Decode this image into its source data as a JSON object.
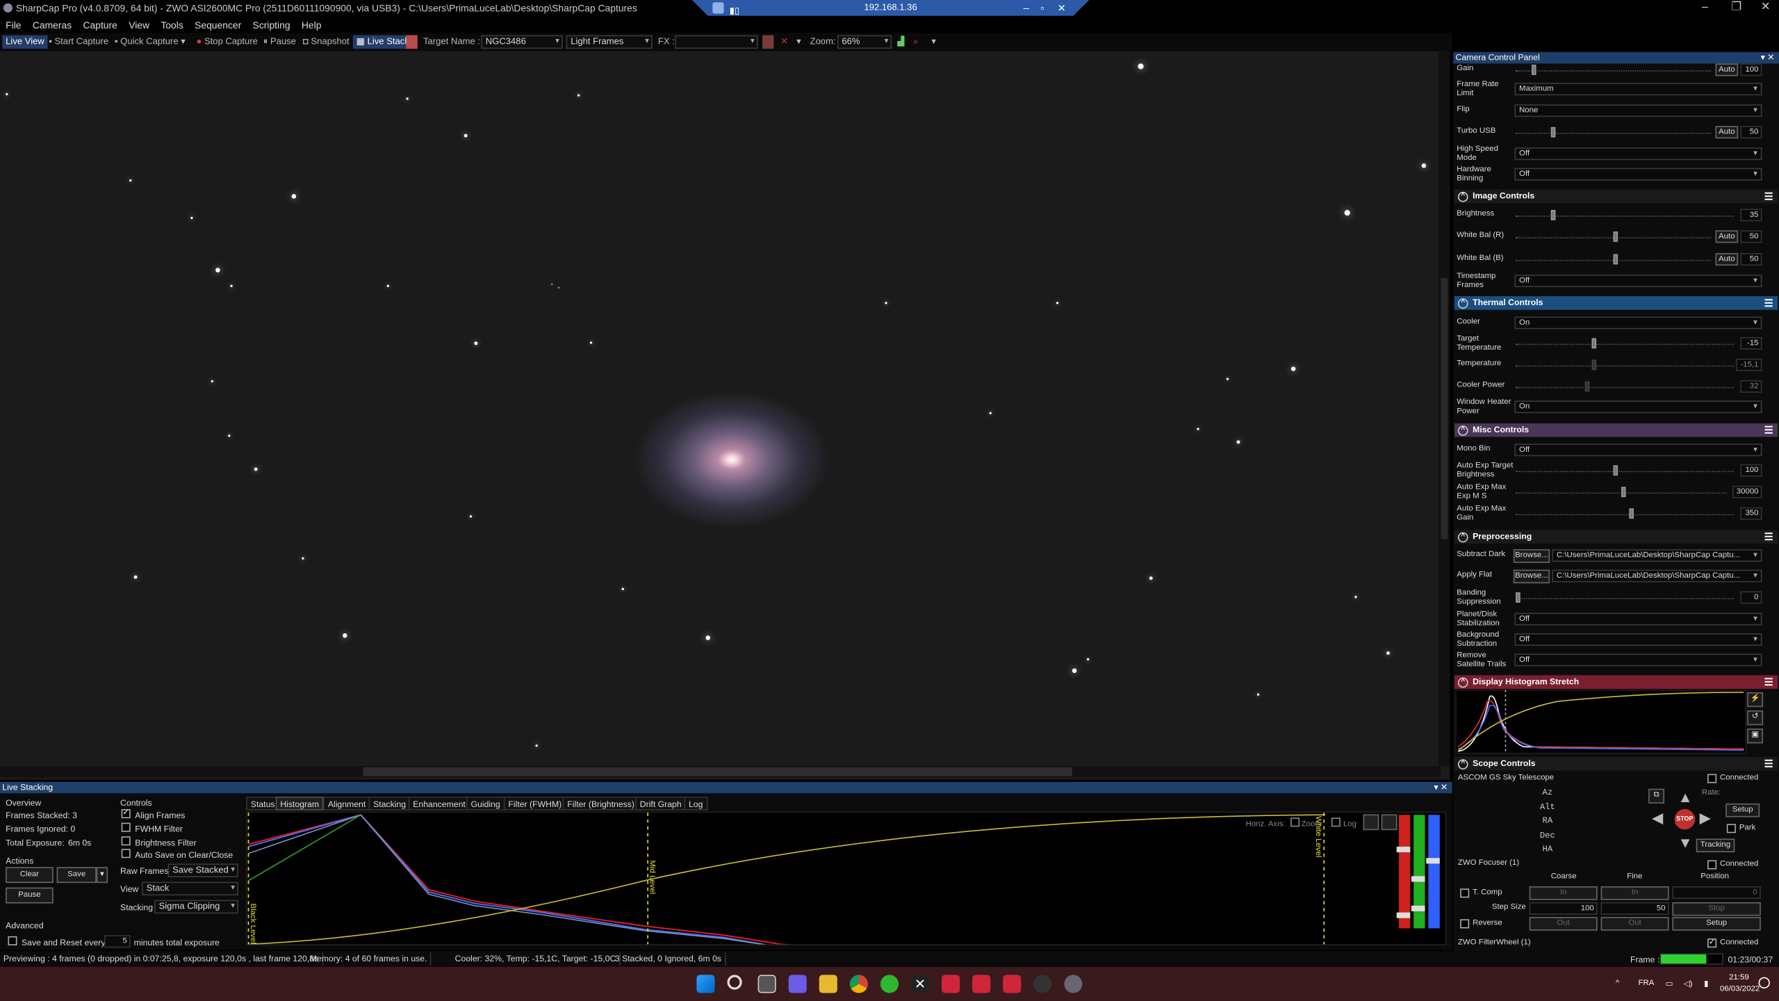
{
  "window": {
    "title": "SharpCap Pro (v4.0.8709, 64 bit) - ZWO ASI2600MC Pro (2511D60111090900, via USB3) - C:\\Users\\PrimaLuceLab\\Desktop\\SharpCap Captures",
    "remote_address": "192.168.1.36"
  },
  "menu": [
    "File",
    "Cameras",
    "Capture",
    "View",
    "Tools",
    "Sequencer",
    "Scripting",
    "Help"
  ],
  "toolbar": {
    "live_view": "Live View",
    "start_capture": "Start Capture",
    "quick_capture": "Quick Capture",
    "stop_capture": "Stop Capture",
    "pause": "Pause",
    "snapshot": "Snapshot",
    "live_stack": "Live Stack",
    "target_name_label": "Target Name :",
    "target_name_value": "NGC3486",
    "frame_type": "Light Frames",
    "fx_label": "FX :",
    "zoom_label": "Zoom:",
    "zoom_value": "66%"
  },
  "camera_panel": {
    "title": "Camera Control Panel",
    "gain": {
      "label": "Gain",
      "auto": "Auto",
      "value": "100",
      "level": 0.08
    },
    "frame_rate": {
      "label": "Frame Rate Limit",
      "value": "Maximum"
    },
    "flip": {
      "label": "Flip",
      "value": "None"
    },
    "turbo_usb": {
      "label": "Turbo USB",
      "auto": "Auto",
      "value": "50",
      "level": 0.18
    },
    "high_speed": {
      "label": "High Speed Mode",
      "value": "Off"
    },
    "hw_binning": {
      "label": "Hardware Binning",
      "value": "Off"
    },
    "image_controls": {
      "title": "Image Controls",
      "brightness": {
        "label": "Brightness",
        "value": "35",
        "level": 0.16
      },
      "wb_r": {
        "label": "White Bal (R)",
        "auto": "Auto",
        "value": "50",
        "level": 0.5
      },
      "wb_b": {
        "label": "White Bal (B)",
        "auto": "Auto",
        "value": "50",
        "level": 0.5
      },
      "timestamp": {
        "label": "Timestamp Frames",
        "value": "Off"
      }
    },
    "thermal_controls": {
      "title": "Thermal Controls",
      "cooler": {
        "label": "Cooler",
        "value": "On"
      },
      "target_temp": {
        "label": "Target Temperature",
        "value": "-15",
        "level": 0.35
      },
      "temperature": {
        "label": "Temperature",
        "value": "-15,1",
        "level": 0.35
      },
      "cooler_power": {
        "label": "Cooler Power",
        "value": "32",
        "level": 0.32
      },
      "window_heater": {
        "label": "Window Heater Power",
        "value": "On"
      }
    },
    "misc_controls": {
      "title": "Misc Controls",
      "mono_bin": {
        "label": "Mono Bin",
        "value": "Off"
      },
      "ae_brightness": {
        "label": "Auto Exp Target Brightness",
        "value": "100",
        "level": 0.45
      },
      "ae_max_exp": {
        "label": "Auto Exp Max Exp M S",
        "value": "30000",
        "level": 0.5
      },
      "ae_max_gain": {
        "label": "Auto Exp Max Gain",
        "value": "350",
        "level": 0.52
      }
    },
    "preprocessing": {
      "title": "Preprocessing",
      "dark": {
        "label": "Subtract Dark",
        "browse": "Browse...",
        "value": "C:\\Users\\PrimaLuceLab\\Desktop\\SharpCap Captu..."
      },
      "flat": {
        "label": "Apply Flat",
        "browse": "Browse...",
        "value": "C:\\Users\\PrimaLuceLab\\Desktop\\SharpCap Captu..."
      },
      "banding": {
        "label": "Banding Suppression",
        "value": "0",
        "level": 0.0
      },
      "stabilization": {
        "label": "Planet/Disk Stabilization",
        "value": "Off"
      },
      "bg_subtraction": {
        "label": "Background Subtraction",
        "value": "Off"
      },
      "satellite": {
        "label": "Remove Satellite Trails",
        "value": "Off"
      }
    },
    "histogram_stretch": {
      "title": "Display Histogram Stretch"
    },
    "scope_controls": {
      "title": "Scope Controls",
      "mount_name": "ASCOM GS Sky Telescope",
      "connected": "Connected",
      "rate": "Rate:",
      "axes": [
        "Az",
        "Alt",
        "RA",
        "Dec",
        "HA"
      ],
      "setup": "Setup",
      "park": "Park",
      "stop": "STOP",
      "tracking": "Tracking",
      "focuser_name": "ZWO Focuser (1)",
      "focuser_cols": [
        "Coarse",
        "Fine",
        "Position"
      ],
      "tcomp": "T. Comp",
      "in": "In",
      "out": "Out",
      "position": "0",
      "step_size": "Step Size",
      "coarse_step": "100",
      "fine_step": "50",
      "stop_btn": "Stop",
      "reverse": "Reverse",
      "focuser_setup": "Setup",
      "filterwheel": "ZWO FilterWheel (1)"
    }
  },
  "live_stacking": {
    "title": "Live Stacking",
    "overview": "Overview",
    "frames_stacked": "Frames Stacked: 3",
    "frames_ignored": "Frames Ignored: 0",
    "total_exposure": "Total Exposure:",
    "total_exposure_value": "6m 0s",
    "actions": "Actions",
    "clear": "Clear",
    "save": "Save",
    "pause": "Pause",
    "advanced": "Advanced",
    "save_reset": "Save and Reset every",
    "save_reset_value": "5",
    "minutes_total": "minutes total exposure",
    "controls": "Controls",
    "align_frames": "Align Frames",
    "fwhm_filter": "FWHM Filter",
    "brightness_filter": "Brightness Filter",
    "auto_save": "Auto Save on Clear/Close",
    "raw_frames": "Raw Frames",
    "raw_frames_value": "Save Stacked",
    "view": "View",
    "view_value": "Stack",
    "stacking": "Stacking",
    "stacking_value": "Sigma Clipping",
    "tabs": [
      "Status",
      "Histogram",
      "Alignment",
      "Stacking",
      "Enhancement",
      "Guiding",
      "Filter (FWHM)",
      "Filter (Brightness)",
      "Drift Graph",
      "Log"
    ],
    "active_tab": 1,
    "hist_black": "Black Level",
    "hist_mid": "Mid Level",
    "hist_white": "White Level",
    "horiz_axis": "Horiz. Axis:",
    "zoom": "Zoom",
    "log": "Log"
  },
  "statusbar": {
    "preview": "Previewing : 4 frames (0 dropped) in 0:07:25,8, exposure 120,0s , last frame 120,8s",
    "memory": "Memory: 4 of 60 frames in use.",
    "cooler": "Cooler: 32%, Temp: -15,1C, Target: -15,0C",
    "stacked": "3 Stacked, 0 Ignored, 6m 0s",
    "frame": "Frame :",
    "frame_time": "01:23/00:37"
  },
  "taskbar": {
    "lang": "FRA",
    "time": "21:59",
    "date": "06/03/2022"
  },
  "colors": {
    "accent": "#1f3f6b",
    "thermal": "#1a4f80",
    "misc": "#4a3656",
    "histstretch": "#7a1f30",
    "taskbar": "#3a1a1c"
  }
}
